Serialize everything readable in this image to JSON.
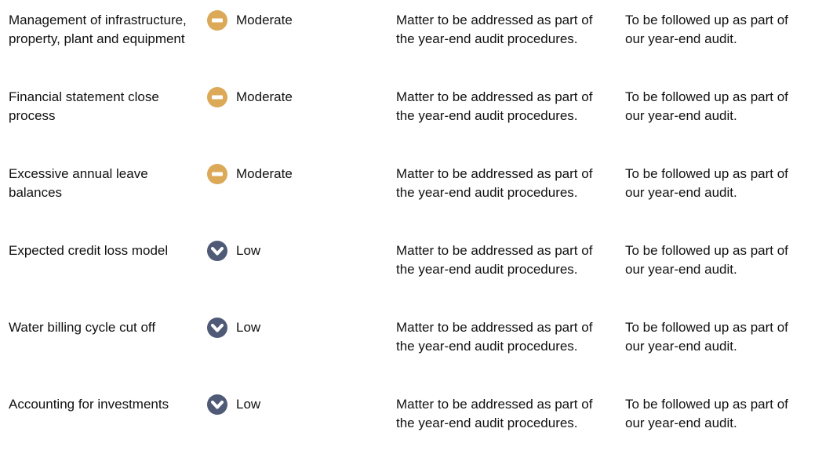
{
  "colors": {
    "moderate": "#dba957",
    "low": "#4f5a76"
  },
  "rows": [
    {
      "area": "Management of infrastructure, property, plant and equipment",
      "rating": "Moderate",
      "rating_icon": "minus-circle-icon",
      "matter": "Matter to be addressed as part of the year-end audit procedures.",
      "action": "To be followed up as part of\nour year-end audit."
    },
    {
      "area": "Financial statement close process",
      "rating": "Moderate",
      "rating_icon": "minus-circle-icon",
      "matter": "Matter to be addressed as part of the year-end audit procedures.",
      "action": "To be followed up as part of\nour year-end audit."
    },
    {
      "area": "Excessive annual leave balances",
      "rating": "Moderate",
      "rating_icon": "minus-circle-icon",
      "matter": "Matter to be addressed as part of the year-end audit procedures.",
      "action": "To be followed up as part of\nour year-end audit."
    },
    {
      "area": "Expected credit loss model",
      "rating": "Low",
      "rating_icon": "chevron-down-circle-icon",
      "matter": "Matter to be addressed as part of the year-end audit procedures.",
      "action": "To be followed up as part of\nour year-end audit."
    },
    {
      "area": "Water billing cycle cut off",
      "rating": "Low",
      "rating_icon": "chevron-down-circle-icon",
      "matter": "Matter to be addressed as part of the year-end audit procedures.",
      "action": "To be followed up as part of\nour year-end audit."
    },
    {
      "area": "Accounting for investments",
      "rating": "Low",
      "rating_icon": "chevron-down-circle-icon",
      "matter": "Matter to be addressed as part of the year-end audit procedures.",
      "action": "To be followed up as part of\nour year-end audit."
    }
  ]
}
